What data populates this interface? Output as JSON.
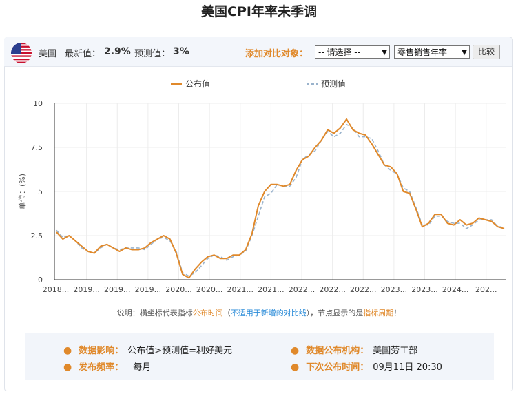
{
  "title": "美国CPI年率未季调",
  "header": {
    "country": "美国",
    "latest_label": "最新值：",
    "latest_value": "2.9%",
    "forecast_label": "预测值：",
    "forecast_value": "3%",
    "compare_label": "添加对比对象：",
    "select1": "-- 请选择 --",
    "select2": "零售销售年率",
    "compare_button": "比较"
  },
  "note": {
    "p1": "说明：横坐标代表指标",
    "p2": "公布时间",
    "p3": "（",
    "p4": "不适用于新增的对比线",
    "p5": "），节点显示的是",
    "p6": "指标周期",
    "p7": "！"
  },
  "info": {
    "impact_label": "数据影响：",
    "impact_value": "公布值>预测值=利好美元",
    "org_label": "数据公布机构：",
    "org_value": "美国劳工部",
    "freq_label": "发布频率：",
    "freq_value": "每月",
    "next_label": "下次公布时间：",
    "next_value": "09月11日 20:30"
  },
  "chart_data": {
    "type": "line",
    "ylabel": "单位：(%)",
    "ylim": [
      0,
      10
    ],
    "yticks": [
      "0",
      "2.5",
      "5",
      "7.5",
      "10"
    ],
    "xticks": [
      "2018...",
      "2019...",
      "2019...",
      "2019...",
      "2020...",
      "2020...",
      "2021...",
      "2021...",
      "2022...",
      "2022...",
      "2022...",
      "2023...",
      "2023...",
      "2024...",
      "202..."
    ],
    "legend": [
      "公布值",
      "预测值"
    ],
    "colors": {
      "actual": "#e0892b",
      "forecast": "#9ab3cc"
    },
    "series": [
      {
        "name": "公布值",
        "values": [
          2.7,
          2.3,
          2.5,
          2.2,
          1.9,
          1.6,
          1.5,
          1.9,
          2.0,
          1.8,
          1.6,
          1.8,
          1.7,
          1.7,
          1.8,
          2.1,
          2.3,
          2.5,
          2.3,
          1.5,
          0.3,
          0.1,
          0.6,
          1.0,
          1.3,
          1.4,
          1.2,
          1.2,
          1.4,
          1.4,
          1.7,
          2.6,
          4.2,
          5.0,
          5.4,
          5.4,
          5.3,
          5.4,
          6.2,
          6.8,
          7.0,
          7.5,
          7.9,
          8.5,
          8.3,
          8.6,
          9.1,
          8.5,
          8.3,
          8.2,
          7.7,
          7.1,
          6.5,
          6.4,
          6.0,
          5.0,
          4.9,
          4.0,
          3.0,
          3.2,
          3.7,
          3.7,
          3.2,
          3.1,
          3.4,
          3.1,
          3.2,
          3.5,
          3.4,
          3.3,
          3.0,
          2.9
        ]
      },
      {
        "name": "预测值",
        "values": [
          2.8,
          2.4,
          2.5,
          2.2,
          1.8,
          1.6,
          1.5,
          1.8,
          2.0,
          1.8,
          1.7,
          1.8,
          1.8,
          1.8,
          1.7,
          2.0,
          2.3,
          2.4,
          2.2,
          1.6,
          0.4,
          0.2,
          0.4,
          0.8,
          1.2,
          1.4,
          1.3,
          1.1,
          1.3,
          1.4,
          1.6,
          2.5,
          3.6,
          4.7,
          4.9,
          5.4,
          5.3,
          5.3,
          5.8,
          6.8,
          7.1,
          7.3,
          7.9,
          8.4,
          8.1,
          8.3,
          8.8,
          8.6,
          8.1,
          8.1,
          8.0,
          7.3,
          6.5,
          6.2,
          6.0,
          5.2,
          5.0,
          4.1,
          3.1,
          3.1,
          3.6,
          3.6,
          3.3,
          3.2,
          3.2,
          2.9,
          3.1,
          3.4,
          3.4,
          3.4,
          3.0,
          3.0
        ]
      }
    ]
  }
}
